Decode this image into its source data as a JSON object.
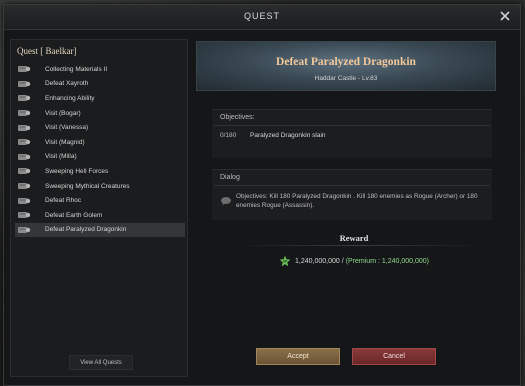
{
  "window": {
    "title": "QUEST"
  },
  "npc": {
    "label": "Quest [ Baelkar]"
  },
  "quests": [
    "Collecting Materials II",
    "Defeat Xayroth",
    "Enhancing Ability",
    "Visit (Bogar)",
    "Visit (Vanessa)",
    "Visit (Magnid)",
    "Visit (Milla)",
    "Sweeping Hell Forces",
    "Sweeping Mythical Creatures",
    "Defeat Rhoc",
    "Defeat Earth Golem",
    "Defeat Paralyzed Dragonkin"
  ],
  "selected_quest": "Defeat Paralyzed Dragonkin",
  "view_all_label": "View All Quests",
  "detail": {
    "title": "Defeat Paralyzed Dragonkin",
    "location": "Haddar Castle - Lv.83",
    "objectives_label": "Objectives:",
    "objective_count": "0/180",
    "objective_text": "Paralyzed Dragonkin slain",
    "dialog_label": "Dialog",
    "dialog_text": "Objectives: Kill 180 Paralyzed Dragonkin . Kill 180 enemies as Rogue (Archer) or 180 enemies Rogue (Assassin)."
  },
  "reward": {
    "label": "Reward",
    "xp_icon": "xp-icon",
    "amount": "1,240,000,000 /",
    "premium": "(Premium : 1,240,000,000)"
  },
  "buttons": {
    "accept": "Accept",
    "cancel": "Cancel"
  },
  "colors": {
    "title": "#f1c89a",
    "premium": "#8fd88f",
    "accept": "#7a6140",
    "cancel": "#7a3030"
  }
}
